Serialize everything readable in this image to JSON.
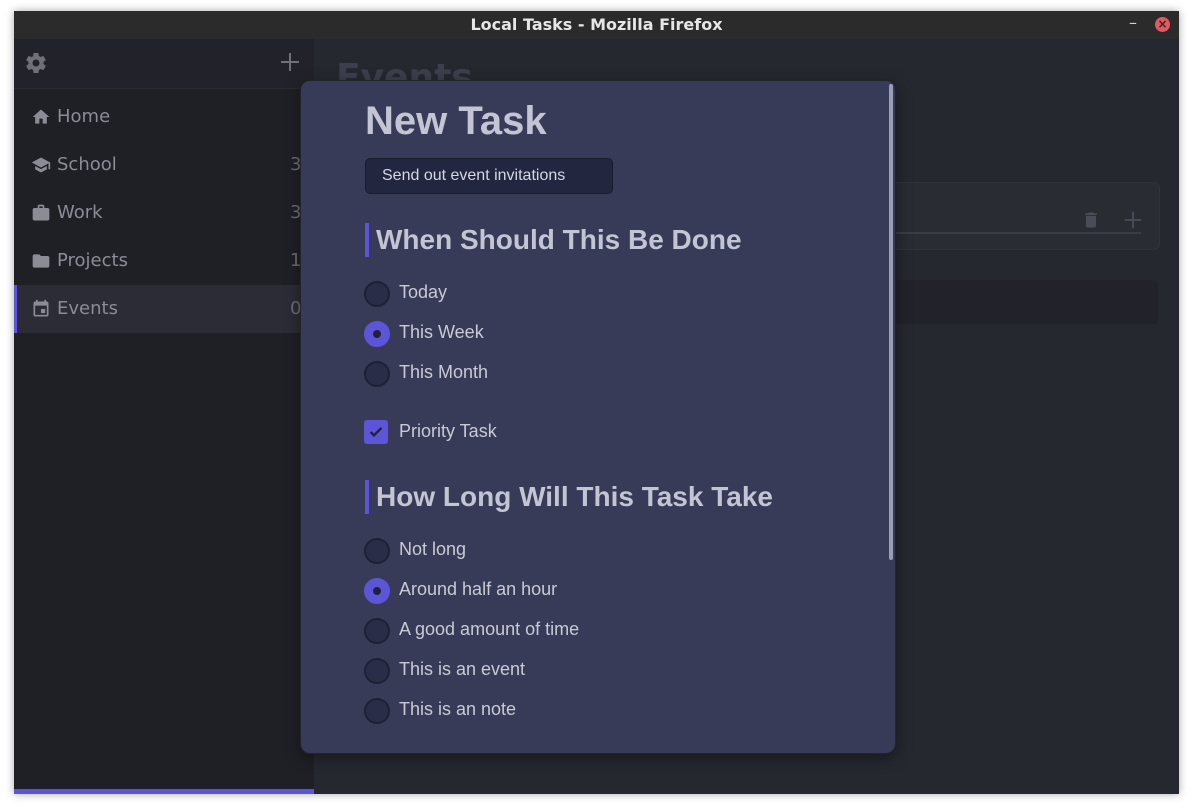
{
  "window": {
    "title": "Local Tasks - Mozilla Firefox",
    "minimize_glyph": "–",
    "close_glyph": "×"
  },
  "sidebar": {
    "items": [
      {
        "label": "Home",
        "count": "",
        "icon": "home-icon"
      },
      {
        "label": "School",
        "count": "3",
        "icon": "graduation-cap-icon"
      },
      {
        "label": "Work",
        "count": "3",
        "icon": "briefcase-icon"
      },
      {
        "label": "Projects",
        "count": "1",
        "icon": "folder-icon"
      },
      {
        "label": "Events",
        "count": "0",
        "icon": "calendar-icon",
        "active": true
      }
    ]
  },
  "main": {
    "page_title": "Events"
  },
  "modal": {
    "heading": "New Task",
    "task_name_value": "Send out event invitations",
    "when_section": {
      "title": "When Should This Be Done",
      "options": [
        {
          "label": "Today",
          "checked": false
        },
        {
          "label": "This Week",
          "checked": true
        },
        {
          "label": "This Month",
          "checked": false
        }
      ]
    },
    "priority": {
      "label": "Priority Task",
      "checked": true
    },
    "duration_section": {
      "title": "How Long Will This Task Take",
      "options": [
        {
          "label": "Not long",
          "checked": false
        },
        {
          "label": "Around half an hour",
          "checked": true
        },
        {
          "label": "A good amount of time",
          "checked": false
        },
        {
          "label": "This is an event",
          "checked": false
        },
        {
          "label": "This is an note",
          "checked": false
        }
      ]
    }
  },
  "colors": {
    "accent": "#5d55d8",
    "modal_bg": "#373b57",
    "sidebar_bg": "#1f2026",
    "main_bg": "#262830"
  }
}
